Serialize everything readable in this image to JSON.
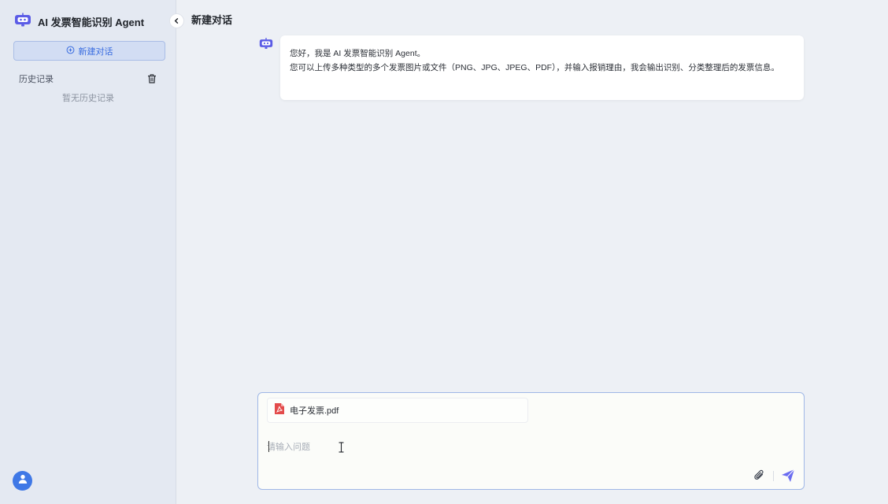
{
  "app": {
    "title": "AI 发票智能识别 Agent"
  },
  "sidebar": {
    "new_chat_label": "新建对话",
    "history_title": "历史记录",
    "history_empty": "暂无历史记录"
  },
  "main": {
    "title": "新建对话",
    "messages": [
      {
        "role": "assistant",
        "lines": [
          "您好，我是 AI 发票智能识别 Agent。",
          "您可以上传多种类型的多个发票图片或文件（PNG、JPG、JPEG、PDF），并输入报销理由，我会输出识别、分类整理后的发票信息。"
        ]
      }
    ]
  },
  "composer": {
    "attachment_name": "电子发票.pdf",
    "input_value": "",
    "placeholder": "请输入问题"
  },
  "icons": {
    "brand": "robot-icon",
    "new_chat": "chat-plus-icon",
    "trash": "trash-icon",
    "collapse": "chevron-left-icon",
    "user": "user-icon",
    "file": "pdf-file-icon",
    "attach": "paperclip-icon",
    "send": "send-icon"
  },
  "colors": {
    "accent": "#3a6de0",
    "brand_icon": "#5b5ce6",
    "send": "#6a6cf0",
    "pdf": "#e34b4b"
  }
}
